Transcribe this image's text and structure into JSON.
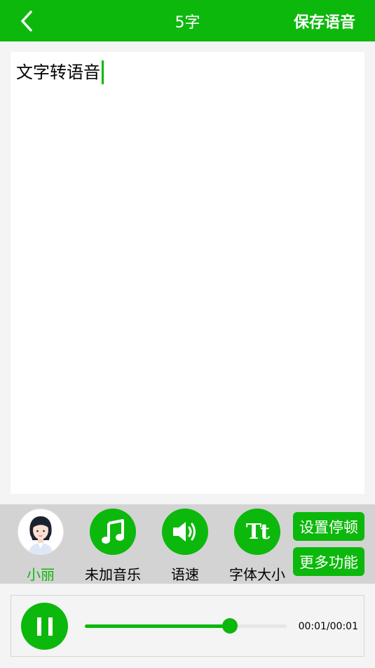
{
  "header": {
    "title": "5字",
    "save_label": "保存语音"
  },
  "editor": {
    "text": "文字转语音"
  },
  "toolbar": {
    "voice_label": "小丽",
    "music_label": "未加音乐",
    "speed_label": "语速",
    "fontsize_label": "字体大小",
    "pause_setting_label": "设置停顿",
    "more_label": "更多功能",
    "fontsize_icon_text": "Tt"
  },
  "player": {
    "time": "00:01/00:01",
    "progress": 0.72,
    "state": "playing"
  },
  "colors": {
    "accent": "#0cb80c",
    "toolbar_bg": "#d3d3d3",
    "page_bg": "#f4f4f4"
  },
  "icons": [
    "back-arrow-icon",
    "music-note-icon",
    "speaker-icon",
    "font-size-icon",
    "pause-icon",
    "avatar-icon"
  ]
}
